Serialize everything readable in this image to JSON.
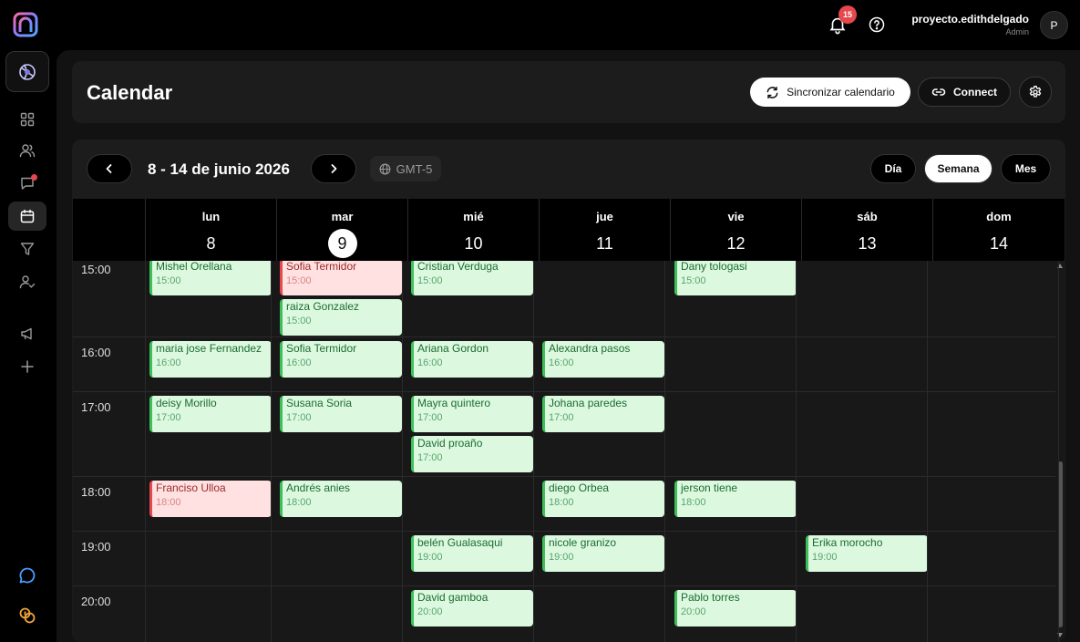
{
  "topbar": {
    "notifications": "15",
    "user": {
      "name": "proyecto.edithdelgado",
      "role": "Admin",
      "initial": "P"
    }
  },
  "page": {
    "title": "Calendar"
  },
  "actions": {
    "sync": "Sincronizar calendario",
    "connect": "Connect"
  },
  "calendar": {
    "range": "8 - 14 de junio 2026",
    "timezone": "GMT-5",
    "views": [
      "Día",
      "Semana",
      "Mes"
    ],
    "active_view": "Semana",
    "days": [
      {
        "name": "lun",
        "num": "8"
      },
      {
        "name": "mar",
        "num": "9"
      },
      {
        "name": "mié",
        "num": "10"
      },
      {
        "name": "jue",
        "num": "11"
      },
      {
        "name": "vie",
        "num": "12"
      },
      {
        "name": "sáb",
        "num": "13"
      },
      {
        "name": "dom",
        "num": "14"
      }
    ],
    "today_index": 1,
    "hours": [
      "15:00",
      "16:00",
      "17:00",
      "18:00",
      "19:00",
      "20:00"
    ],
    "events": [
      {
        "name": "Mishel Orellana",
        "time": "15:00",
        "day": 0,
        "hour": 0,
        "slot": 0,
        "status": "confirmed"
      },
      {
        "name": "Sofia Termidor",
        "time": "15:00",
        "day": 1,
        "hour": 0,
        "slot": 0,
        "status": "cancelled"
      },
      {
        "name": "raiza Gonzalez",
        "time": "15:00",
        "day": 1,
        "hour": 0,
        "slot": 1,
        "status": "confirmed"
      },
      {
        "name": "Cristian Verduga",
        "time": "15:00",
        "day": 2,
        "hour": 0,
        "slot": 0,
        "status": "confirmed"
      },
      {
        "name": "Dany tologasi",
        "time": "15:00",
        "day": 4,
        "hour": 0,
        "slot": 0,
        "status": "confirmed"
      },
      {
        "name": "maria jose Fernandez",
        "time": "16:00",
        "day": 0,
        "hour": 1,
        "slot": 0,
        "status": "confirmed"
      },
      {
        "name": "Sofia Termidor",
        "time": "16:00",
        "day": 1,
        "hour": 1,
        "slot": 0,
        "status": "confirmed"
      },
      {
        "name": "Ariana Gordon",
        "time": "16:00",
        "day": 2,
        "hour": 1,
        "slot": 0,
        "status": "confirmed"
      },
      {
        "name": "Alexandra pasos",
        "time": "16:00",
        "day": 3,
        "hour": 1,
        "slot": 0,
        "status": "confirmed"
      },
      {
        "name": "deisy Morillo",
        "time": "17:00",
        "day": 0,
        "hour": 2,
        "slot": 0,
        "status": "confirmed"
      },
      {
        "name": "Susana Soria",
        "time": "17:00",
        "day": 1,
        "hour": 2,
        "slot": 0,
        "status": "confirmed"
      },
      {
        "name": "Mayra quintero",
        "time": "17:00",
        "day": 2,
        "hour": 2,
        "slot": 0,
        "status": "confirmed"
      },
      {
        "name": "David proaño",
        "time": "17:00",
        "day": 2,
        "hour": 2,
        "slot": 1,
        "status": "confirmed"
      },
      {
        "name": "Johana paredes",
        "time": "17:00",
        "day": 3,
        "hour": 2,
        "slot": 0,
        "status": "confirmed"
      },
      {
        "name": "Franciso Ulloa",
        "time": "18:00",
        "day": 0,
        "hour": 3,
        "slot": 0,
        "status": "cancelled"
      },
      {
        "name": "Andrés anies",
        "time": "18:00",
        "day": 1,
        "hour": 3,
        "slot": 0,
        "status": "confirmed"
      },
      {
        "name": "diego Orbea",
        "time": "18:00",
        "day": 3,
        "hour": 3,
        "slot": 0,
        "status": "confirmed"
      },
      {
        "name": "jerson tiene",
        "time": "18:00",
        "day": 4,
        "hour": 3,
        "slot": 0,
        "status": "confirmed"
      },
      {
        "name": "belén Gualasaqui",
        "time": "19:00",
        "day": 2,
        "hour": 4,
        "slot": 0,
        "status": "confirmed"
      },
      {
        "name": "nicole granizo",
        "time": "19:00",
        "day": 3,
        "hour": 4,
        "slot": 0,
        "status": "confirmed"
      },
      {
        "name": "Erika morocho",
        "time": "19:00",
        "day": 5,
        "hour": 4,
        "slot": 0,
        "status": "confirmed"
      },
      {
        "name": "David gamboa",
        "time": "20:00",
        "day": 2,
        "hour": 5,
        "slot": 0,
        "status": "confirmed"
      },
      {
        "name": "Pablo torres",
        "time": "20:00",
        "day": 4,
        "hour": 5,
        "slot": 0,
        "status": "confirmed"
      }
    ]
  },
  "icons": {
    "logo": "app-logo-icon",
    "bell": "bell-icon",
    "help": "help-circle-icon",
    "sync": "refresh-icon",
    "connect": "link-icon",
    "settings": "gear-icon",
    "prev": "chevron-left-icon",
    "next": "chevron-right-icon",
    "globe": "globe-icon"
  },
  "colors": {
    "event_confirmed_bg": "#dcf9e0",
    "event_confirmed_border": "#3fbf5a",
    "event_cancelled_bg": "#ffe1e1",
    "event_cancelled_border": "#e5484d",
    "badge": "#e5484d"
  }
}
